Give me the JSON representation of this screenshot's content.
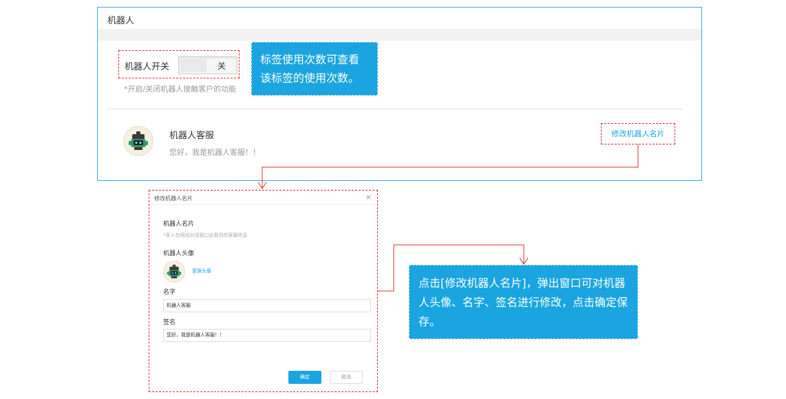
{
  "panel": {
    "title": "机器人",
    "switch_label": "机器人开关",
    "switch_state": "关",
    "switch_hint": "*开启/关闭机器人接触客户的功能"
  },
  "tips": {
    "tag_usage": "标签使用次数可查看该标签的使用次数。",
    "edit_card": "点击[修改机器人名片]，弹出窗口可对机器人头像、名字、签名进行修改，点击确定保存。"
  },
  "robot": {
    "name": "机器人客服",
    "signature": "您好，我是机器人客服！！",
    "edit_button": "修改机器人名片",
    "avatar_icon": "robot-icon"
  },
  "dialog": {
    "title": "修改机器人名片",
    "close": "×",
    "section_title": "机器人名片",
    "section_hint": "*客人在网站对话窗口会看到的客服信息",
    "avatar_label": "机器人头像",
    "change_avatar": "更换头像",
    "name_label": "名字",
    "name_value": "机器人客服",
    "sign_label": "签名",
    "sign_value": "您好，我是机器人客服！！",
    "ok_label": "确定",
    "cancel_label": "取消"
  },
  "colors": {
    "accent": "#1aa5e0",
    "annotation_border": "#e02b2b",
    "panel_border": "#3fa8d9"
  }
}
